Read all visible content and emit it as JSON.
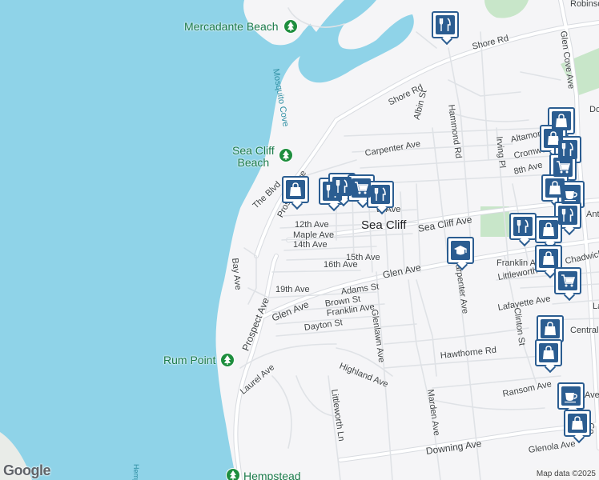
{
  "map": {
    "colors": {
      "land": "#f5f5f7",
      "water": "#8fd3e8",
      "road": "#ffffff",
      "road_casing": "#d8dbe0",
      "park": "#c8e6c9",
      "poi_blue": "#2b5d91",
      "park_green": "#1e8e3e"
    },
    "town_label": "Sea Cliff",
    "places": [
      {
        "id": "mercadante",
        "label": "Mercadante Beach"
      },
      {
        "id": "seacliffbeach",
        "label": "Sea Cliff\nBeach"
      },
      {
        "id": "rumpoint",
        "label": "Rum Point"
      },
      {
        "id": "hempstead",
        "label": "Hempstead"
      }
    ],
    "water_labels": [
      "Mosquito Cove",
      "Hempstead"
    ],
    "streets": [
      "Shore Rd",
      "Shore Rd",
      "Albin St",
      "Hammond Rd",
      "Glen Cove Ave",
      "Robinson",
      "Do",
      "Altamont",
      "Cromwell",
      "Carpenter Ave",
      "Irving Pl",
      "8th Ave",
      "The Blvd",
      "Prospect Ave",
      "12th Ave",
      "Maple Ave",
      "14th Ave",
      "15th Ave",
      "16th Ave",
      "Sea Cliff Ave",
      "Glen Ave",
      "Bay Ave",
      "19th Ave",
      "Adams St",
      "Brown St",
      "Franklin Ave",
      "Dayton St",
      "Glen Ave",
      "Prospect Ave",
      "Glenlawn Ave",
      "Carpenter Ave",
      "Franklin Ave",
      "Littleworth",
      "Chadwick",
      "Lafayette Ave",
      "Clinton St",
      "Central",
      "Hawthorne Rd",
      "Laurel Ave",
      "Highland Ave",
      "Littleworth Ln",
      "Marden Ave",
      "Ransom Ave",
      "Downing Ave",
      "Glenola Ave",
      "Co",
      "Antin",
      "Ave",
      "th Ave",
      "Lay"
    ],
    "poi_icons": [
      "restaurant-icon",
      "shopping-icon",
      "restaurant-icon",
      "restaurant-icon",
      "shopping-cart-icon",
      "restaurant-icon",
      "shopping-icon",
      "shopping-icon",
      "restaurant-icon",
      "shopping-cart-icon",
      "shopping-icon",
      "cafe-icon",
      "restaurant-icon",
      "restaurant-icon",
      "shopping-icon",
      "shopping-icon",
      "shopping-cart-icon",
      "shopping-icon",
      "shopping-icon",
      "cafe-icon",
      "shopping-icon",
      "school-icon"
    ]
  },
  "attribution": {
    "logo": "Google",
    "text": "Map data ©2025"
  }
}
